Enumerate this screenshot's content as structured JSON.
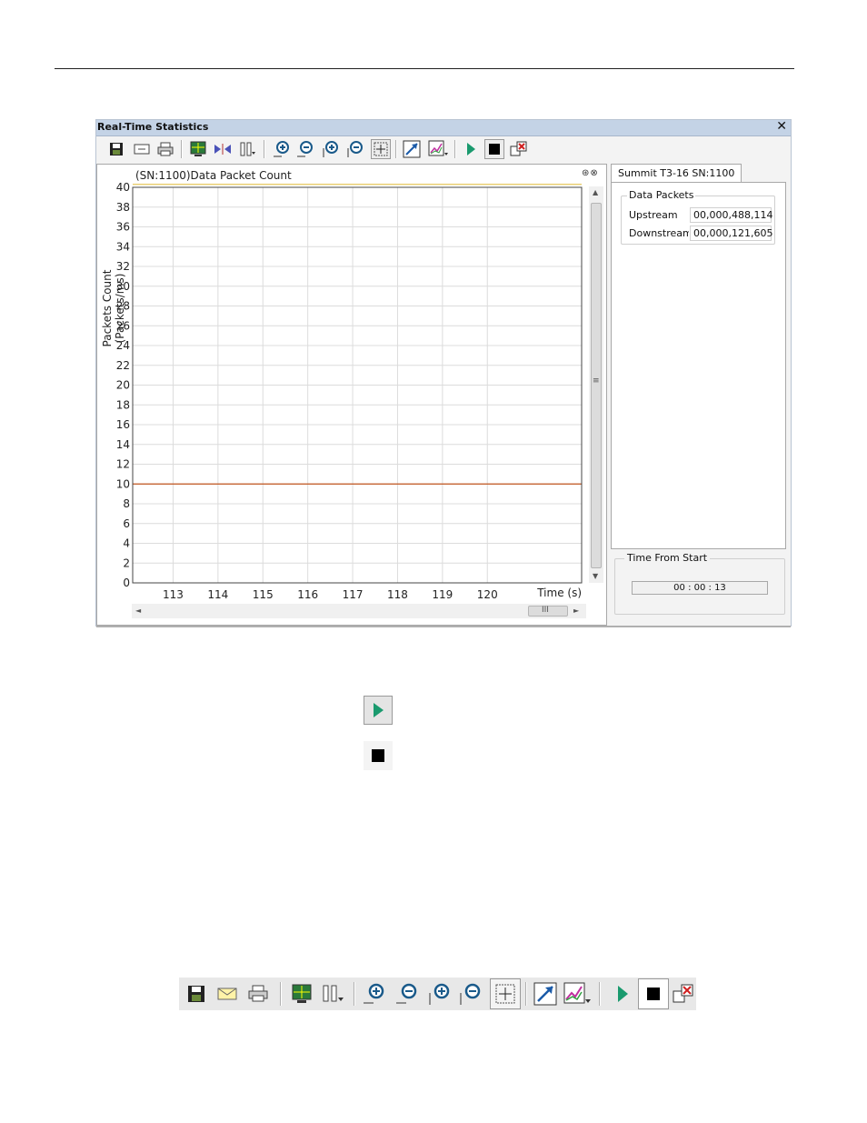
{
  "window": {
    "title": "Real-Time Statistics",
    "close_label": "✕"
  },
  "toolbar": {
    "items": [
      "save-icon",
      "email-icon",
      "print-icon",
      "display-settings-icon",
      "split-icon",
      "configure-icon",
      "zoom-in-horizontal-icon",
      "zoom-out-horizontal-icon",
      "zoom-in-vertical-icon",
      "zoom-out-vertical-icon",
      "cursor-crosshair-icon",
      "auto-scale-icon",
      "chart-options-icon",
      "play-icon",
      "stop-icon",
      "detach-icon"
    ]
  },
  "chart": {
    "title": "(SN:1100)Data Packet Count",
    "controls": "⊛⊗",
    "ylabel": "Packets Count (Packets/ms)",
    "xunit_label": "Time (s)"
  },
  "chart_data": {
    "type": "line",
    "title": "(SN:1100)Data Packet Count",
    "xlabel": "Time (s)",
    "ylabel": "Packets Count (Packets/ms)",
    "x_ticks": [
      "113",
      "114",
      "115",
      "116",
      "117",
      "118",
      "119",
      "120"
    ],
    "y_ticks": [
      "0",
      "2",
      "4",
      "6",
      "8",
      "10",
      "12",
      "14",
      "16",
      "18",
      "20",
      "22",
      "24",
      "26",
      "28",
      "30",
      "32",
      "34",
      "36",
      "38",
      "40"
    ],
    "xlim": [
      112.1,
      122.1
    ],
    "ylim": [
      0,
      40
    ],
    "grid": true,
    "series": [
      {
        "x": [
          112.1,
          122.1
        ],
        "values": [
          10,
          10
        ],
        "color": "#c0541e"
      },
      {
        "x": [
          112.1,
          122.1
        ],
        "values": [
          40.3,
          40.3
        ],
        "color": "#e6c65a"
      }
    ]
  },
  "side": {
    "tab_label": "Summit T3-16 SN:1100",
    "group_title": "Data Packets",
    "rows": [
      {
        "label": "Upstream",
        "value": "00,000,488,114"
      },
      {
        "label": "Downstream",
        "value": "00,000,121,605"
      }
    ],
    "time_group_title": "Time From Start",
    "time_value": "00 : 00 : 13"
  },
  "scroll": {
    "vthumb_grip": "≡",
    "hthumb_grip": "III",
    "up": "▲",
    "down": "▼",
    "left": "◄",
    "right": "►"
  },
  "colors": {
    "titlebar": "#c4d3e6",
    "accent_play": "#1a9a6e",
    "trace": "#c0541e"
  }
}
